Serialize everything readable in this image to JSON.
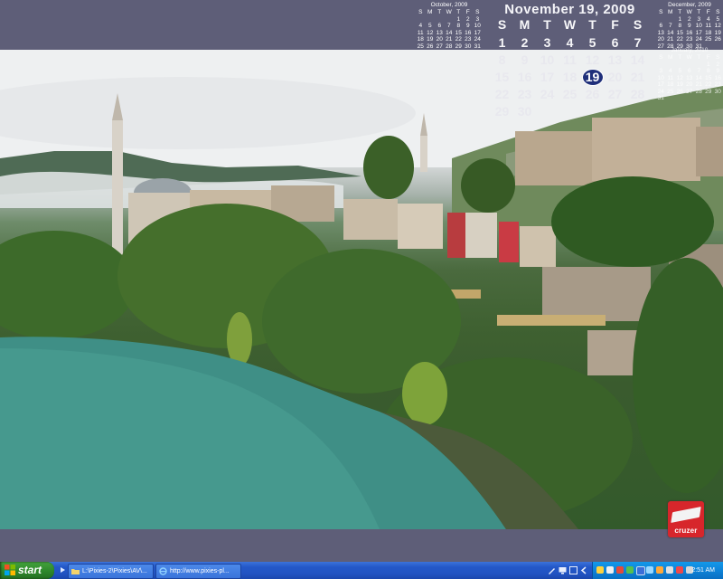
{
  "calendar": {
    "title": "November 19, 2009",
    "weekdays": [
      "S",
      "M",
      "T",
      "W",
      "T",
      "F",
      "S"
    ],
    "weeks": [
      [
        "1",
        "2",
        "3",
        "4",
        "5",
        "6",
        "7"
      ],
      [
        "8",
        "9",
        "10",
        "11",
        "12",
        "13",
        "14"
      ],
      [
        "15",
        "16",
        "17",
        "18",
        "19",
        "20",
        "21"
      ],
      [
        "22",
        "23",
        "24",
        "25",
        "26",
        "27",
        "28"
      ],
      [
        "29",
        "30",
        "",
        "",
        "",
        "",
        ""
      ]
    ],
    "today": "19"
  },
  "mini_calendars": {
    "prev": {
      "title": "October, 2009",
      "weekdays": [
        "S",
        "M",
        "T",
        "W",
        "T",
        "F",
        "S"
      ],
      "weeks": [
        [
          "",
          "",
          "",
          "",
          "1",
          "2",
          "3"
        ],
        [
          "4",
          "5",
          "6",
          "7",
          "8",
          "9",
          "10"
        ],
        [
          "11",
          "12",
          "13",
          "14",
          "15",
          "16",
          "17"
        ],
        [
          "18",
          "19",
          "20",
          "21",
          "22",
          "23",
          "24"
        ],
        [
          "25",
          "26",
          "27",
          "28",
          "29",
          "30",
          "31"
        ]
      ]
    },
    "next": {
      "title": "December, 2009",
      "weekdays": [
        "S",
        "M",
        "T",
        "W",
        "T",
        "F",
        "S"
      ],
      "weeks": [
        [
          "",
          "",
          "1",
          "2",
          "3",
          "4",
          "5"
        ],
        [
          "6",
          "7",
          "8",
          "9",
          "10",
          "11",
          "12"
        ],
        [
          "13",
          "14",
          "15",
          "16",
          "17",
          "18",
          "19"
        ],
        [
          "20",
          "21",
          "22",
          "23",
          "24",
          "25",
          "26"
        ],
        [
          "27",
          "28",
          "29",
          "30",
          "31",
          "",
          ""
        ]
      ]
    },
    "next2": {
      "title": "January, 2010",
      "weekdays": [
        "S",
        "M",
        "T",
        "W",
        "T",
        "F",
        "S"
      ],
      "weeks": [
        [
          "",
          "",
          "",
          "",
          "",
          "1",
          "2"
        ],
        [
          "3",
          "4",
          "5",
          "6",
          "7",
          "8",
          "9"
        ],
        [
          "10",
          "11",
          "12",
          "13",
          "14",
          "15",
          "16"
        ],
        [
          "17",
          "18",
          "19",
          "20",
          "21",
          "22",
          "23"
        ],
        [
          "24",
          "25",
          "26",
          "27",
          "28",
          "29",
          "30"
        ],
        [
          "31",
          "",
          "",
          "",
          "",
          "",
          ""
        ]
      ]
    }
  },
  "logo": {
    "text": "cruzer"
  },
  "taskbar": {
    "start_label": "start",
    "tasks": [
      {
        "label": "L:\\Pixies-2\\Pixies\\AV\\...",
        "icon": "folder-icon"
      },
      {
        "label": "http://www.pixies-pl...",
        "icon": "ie-icon"
      }
    ],
    "clock": "2:51 AM"
  },
  "colors": {
    "desktop_bg": "#5e5e78",
    "taskbar": "#2458c8",
    "start": "#2f8a2c",
    "today_circle": "#1f2f7a",
    "logo_red": "#d7262b"
  }
}
